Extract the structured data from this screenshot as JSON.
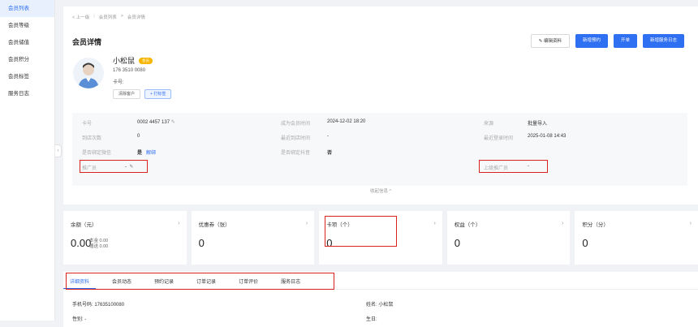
{
  "sidebar": {
    "items": [
      {
        "label": "会员列表",
        "active": true
      },
      {
        "label": "会员等级",
        "active": false
      },
      {
        "label": "会员储值",
        "active": false
      },
      {
        "label": "会员积分",
        "active": false
      },
      {
        "label": "会员标签",
        "active": false
      },
      {
        "label": "服务日志",
        "active": false
      }
    ]
  },
  "breadcrumb": {
    "back": "< 上一级",
    "list": "会员列表",
    "current": "会员详情",
    "sep": ">"
  },
  "header": {
    "title": "会员详情"
  },
  "actions": {
    "edit": "编辑资料",
    "new_booking": "新增预约",
    "open_order": "开单",
    "new_log": "新增服务日志"
  },
  "member": {
    "name": "小松鼠",
    "badge": "会员",
    "phone": "176 3510 0080",
    "card_label": "卡号:",
    "btn_clear": "清除客户",
    "btn_tag": "+ 打标签"
  },
  "info": {
    "card_no_label": "卡号",
    "card_no": "0002 4457 137",
    "became_label": "成为会员时间",
    "became": "2024-12-02 18:20",
    "source_label": "来源",
    "source": "批量导入",
    "visits_label": "到店次数",
    "visits": "0",
    "last_visit_label": "最近到店时间",
    "last_visit": "-",
    "last_login_label": "最近登录时间",
    "last_login": "2025-01-08 14:43",
    "bind_wechat_label": "是否绑定微信",
    "bind_wechat": "是",
    "unbind": "解绑",
    "bind_sale_label": "是否绑定抖音",
    "bind_sale": "否",
    "promoter_label": "推广员",
    "promoter": "-",
    "upper_promoter_label": "上级推广员",
    "upper_promoter": "-",
    "collapse": "收起信息 ^"
  },
  "stats": [
    {
      "title": "余额（元）",
      "value": "0.00",
      "sub1": "本金 0.00",
      "sub2": "赠送 0.00"
    },
    {
      "title": "优惠券（张）",
      "value": "0"
    },
    {
      "title": "卡项（个）",
      "value": "0"
    },
    {
      "title": "权益（个）",
      "value": "0"
    },
    {
      "title": "积分（分）",
      "value": "0"
    }
  ],
  "tabs": [
    "详细资料",
    "会员动态",
    "预约记录",
    "订单记录",
    "订单评价",
    "服务日志"
  ],
  "detail": {
    "phone": "手机号码: 17635100080",
    "name": "姓名: 小松鼠",
    "gender": "性别: -",
    "birthday": "生日: "
  },
  "colors": {
    "accent": "#2f6ff2",
    "highlight": "#d9211e",
    "vip": "#f7b500"
  }
}
